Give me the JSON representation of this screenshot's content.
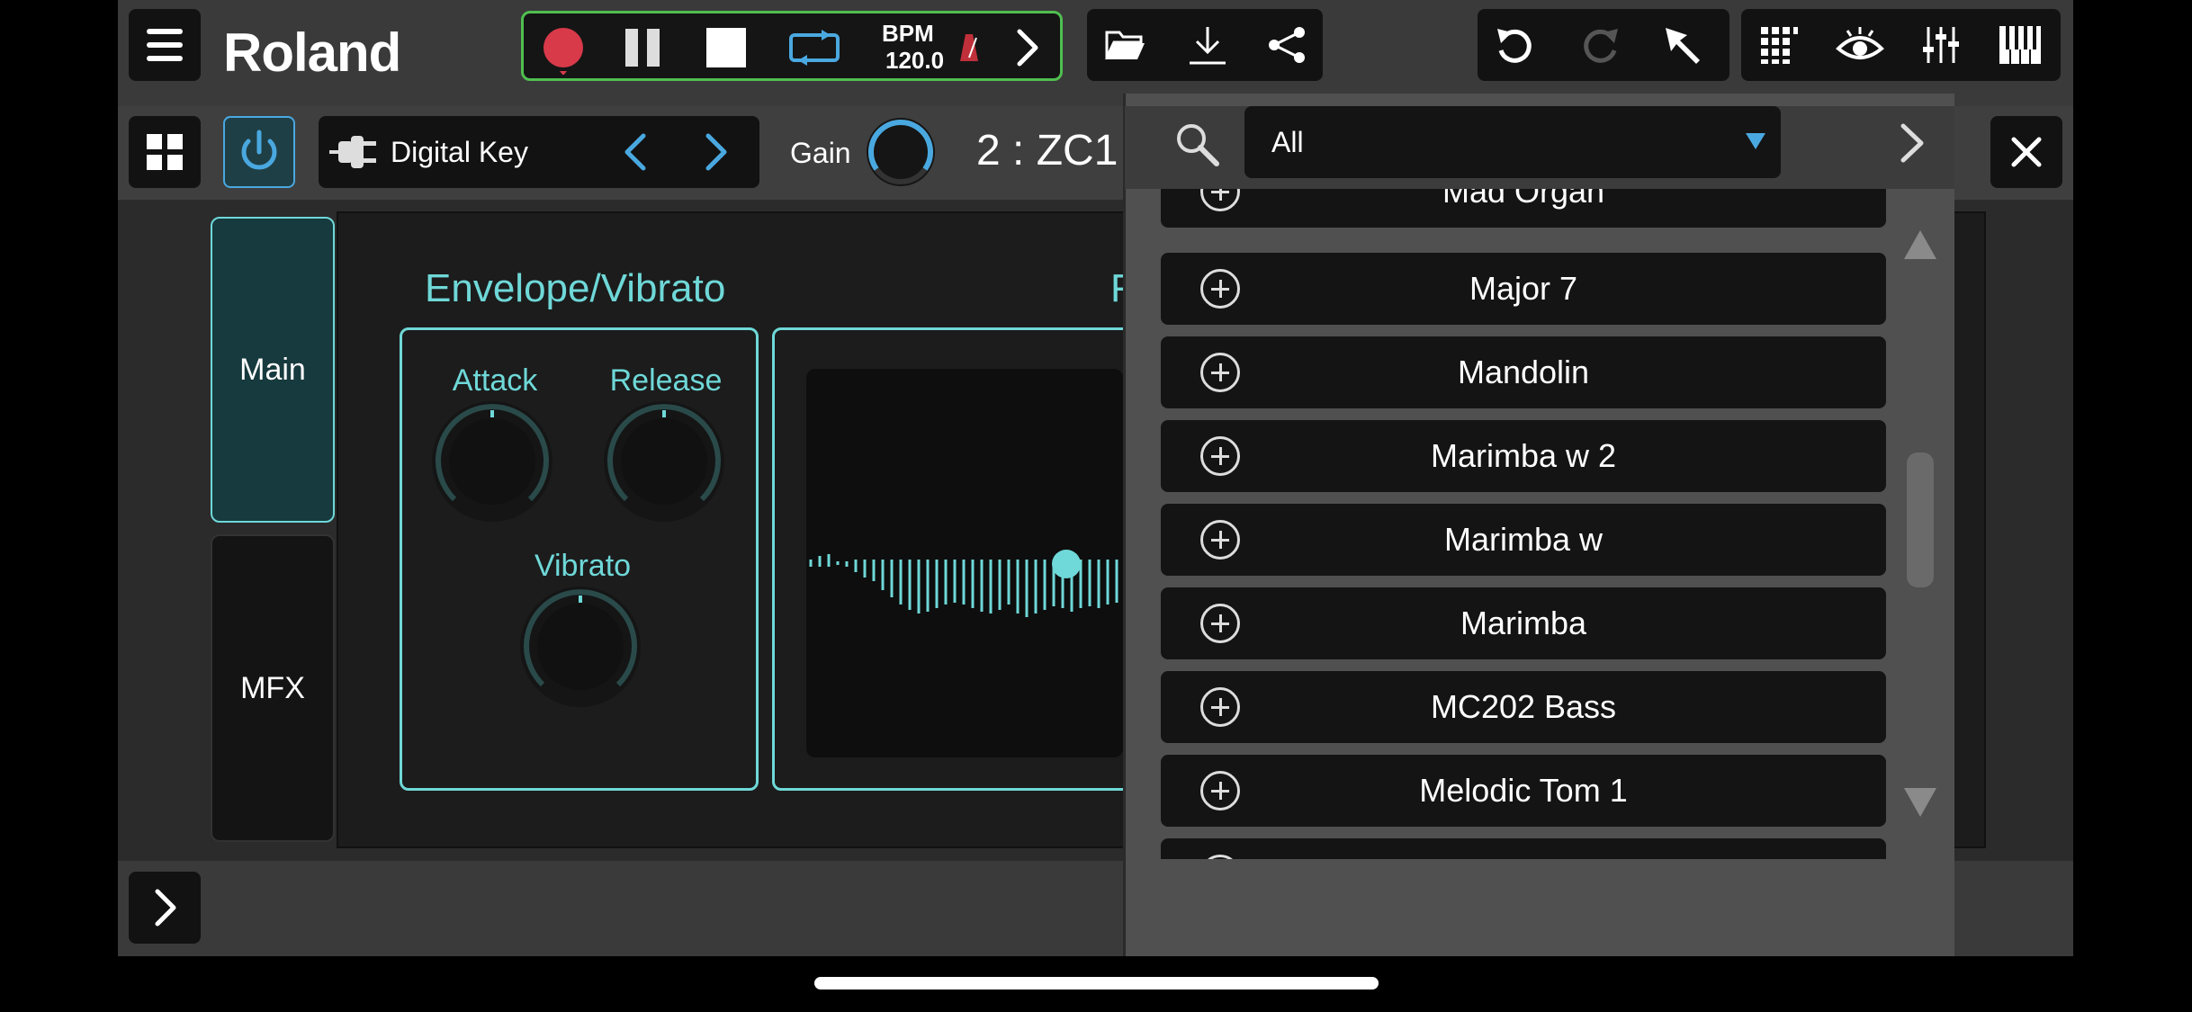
{
  "brand": "Roland",
  "transport": {
    "bpm_label": "BPM",
    "bpm_value": "120.0"
  },
  "toolbar2": {
    "instrument_name": "Digital Key",
    "gain_label": "Gain",
    "part_label": "2 : ZC1"
  },
  "tabs": [
    "Main",
    "MFX"
  ],
  "envelope": {
    "title": "Envelope/Vibrato",
    "attack": "Attack",
    "release": "Release",
    "vibrato": "Vibrato"
  },
  "second_section_title_partial": "F",
  "browser": {
    "filter_value": "All",
    "items": [
      "Mad Organ",
      "Major 7",
      "Mandolin",
      "Marimba w 2",
      "Marimba w",
      "Marimba",
      "MC202 Bass",
      "Melodic Tom 1"
    ]
  },
  "colors": {
    "accent": "#6fd8d8",
    "record": "#d83a4a",
    "transport_border": "#4fbf4f",
    "icon_blue": "#4aa8e0"
  }
}
